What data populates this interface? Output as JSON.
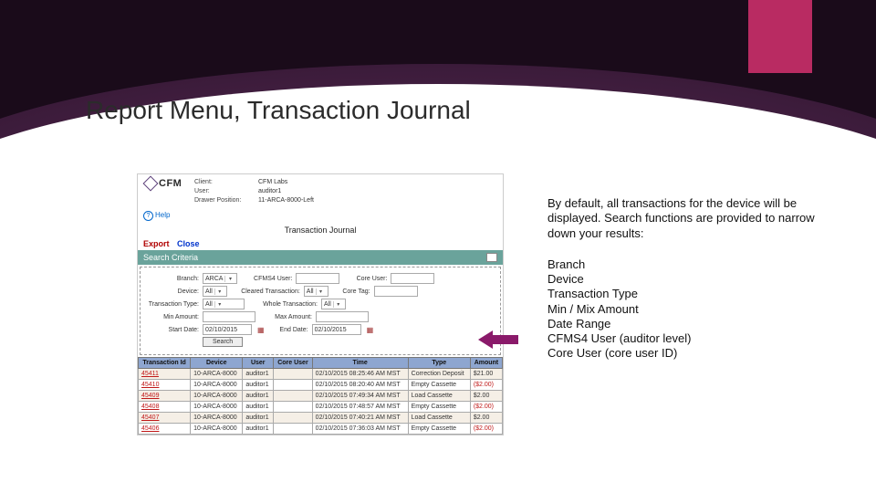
{
  "title": "Report Menu, Transaction Journal",
  "logo_text": "CFM",
  "meta": {
    "client_lbl": "Client:",
    "client_val": "CFM Labs",
    "user_lbl": "User:",
    "user_val": "auditor1",
    "pos_lbl": "Drawer Position:",
    "pos_val": "11-ARCA-8000-Left"
  },
  "help": "Help",
  "journal_title": "Transaction Journal",
  "links": {
    "export": "Export",
    "close": "Close"
  },
  "search_header": "Search Criteria",
  "form": {
    "branch_lbl": "Branch:",
    "branch_val": "ARCA",
    "cfms_lbl": "CFMS4 User:",
    "cfms_val": "",
    "coreuser_lbl": "Core User:",
    "coreuser_val": "",
    "device_lbl": "Device:",
    "device_val": "All",
    "cleared_lbl": "Cleared Transaction:",
    "cleared_val": "All",
    "coretag_lbl": "Core Tag:",
    "coretag_val": "",
    "ttype_lbl": "Transaction Type:",
    "ttype_val": "All",
    "whole_lbl": "Whole Transaction:",
    "whole_val": "All",
    "min_lbl": "Min Amount:",
    "min_val": "",
    "max_lbl": "Max Amount:",
    "max_val": "",
    "start_lbl": "Start Date:",
    "start_val": "02/10/2015",
    "end_lbl": "End Date:",
    "end_val": "02/10/2015",
    "search_btn": "Search"
  },
  "cols": {
    "id": "Transaction Id",
    "device": "Device",
    "user": "User",
    "coreuser": "Core User",
    "time": "Time",
    "type": "Type",
    "amount": "Amount"
  },
  "rows": [
    {
      "id": "45411",
      "device": "10-ARCA-8000",
      "user": "auditor1",
      "cu": "",
      "time": "02/10/2015 08:25:46 AM MST",
      "type": "Correction Deposit",
      "amt": "$21.00"
    },
    {
      "id": "45410",
      "device": "10-ARCA-8000",
      "user": "auditor1",
      "cu": "",
      "time": "02/10/2015 08:20:40 AM MST",
      "type": "Empty Cassette",
      "amt": "($2.00)"
    },
    {
      "id": "45409",
      "device": "10-ARCA-8000",
      "user": "auditor1",
      "cu": "",
      "time": "02/10/2015 07:49:34 AM MST",
      "type": "Load Cassette",
      "amt": "$2.00"
    },
    {
      "id": "45408",
      "device": "10-ARCA-8000",
      "user": "auditor1",
      "cu": "",
      "time": "02/10/2015 07:48:57 AM MST",
      "type": "Empty Cassette",
      "amt": "($2.00)"
    },
    {
      "id": "45407",
      "device": "10-ARCA-8000",
      "user": "auditor1",
      "cu": "",
      "time": "02/10/2015 07:40:21 AM MST",
      "type": "Load Cassette",
      "amt": "$2.00"
    },
    {
      "id": "45406",
      "device": "10-ARCA-8000",
      "user": "auditor1",
      "cu": "",
      "time": "02/10/2015 07:36:03 AM MST",
      "type": "Empty Cassette",
      "amt": "($2.00)"
    }
  ],
  "explain": {
    "para": "By default, all transactions for the device will be displayed. Search functions are provided to narrow down your results:",
    "items": [
      "Branch",
      "Device",
      "Transaction Type",
      "Min / Mix Amount",
      "Date Range",
      "CFMS4 User (auditor level)",
      "Core User (core user ID)"
    ]
  }
}
